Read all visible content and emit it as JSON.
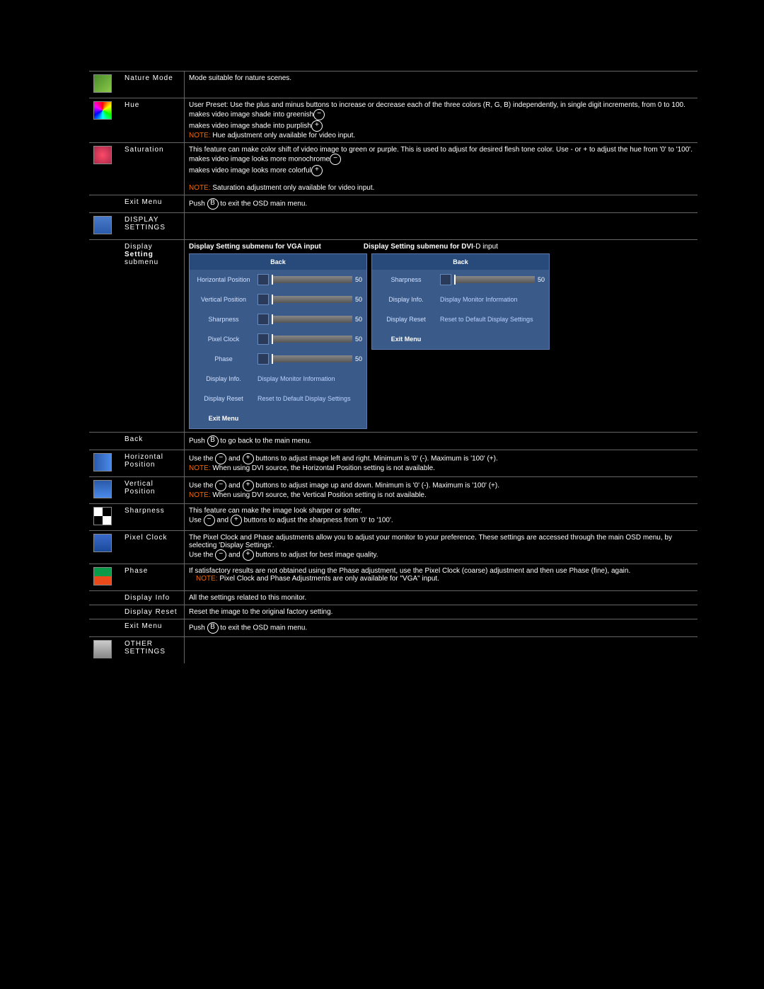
{
  "rows": [
    {
      "icon": "nature-icon",
      "label": "Nature Mode",
      "desc": [
        {
          "t": "Mode suitable for nature scenes."
        }
      ]
    },
    {
      "icon": "hue-icon",
      "label": "Hue",
      "desc": [
        {
          "t": "User Preset: Use the plus and minus buttons to increase or decrease each of the three colors (R, G, B) independently, in single digit increments, from 0 to 100."
        },
        {
          "ico": "-",
          "t": " makes video image shade into greenish"
        },
        {
          "ico": "+",
          "t": " makes video image shade into purplish"
        },
        {
          "note": "NOTE:",
          "t": " Hue adjustment only available for video input."
        }
      ]
    },
    {
      "icon": "saturation-icon",
      "label": "Saturation",
      "desc": [
        {
          "t": "This feature can make color shift of video image to green or purple. This is used to adjust for desired flesh tone color. Use - or + to adjust the hue from '0' to '100'."
        },
        {
          "ico": "-",
          "t": " makes video image looks more monochrome"
        },
        {
          "ico": "+",
          "t": " makes video image looks more colorful"
        },
        {
          "br": 1
        },
        {
          "note": "NOTE:",
          "t": " Saturation adjustment only available for video input."
        }
      ]
    },
    {
      "label": "Exit Menu",
      "desc": [
        {
          "t": "Push ",
          "ico2": "B",
          "t2": " to exit the OSD main menu."
        }
      ]
    },
    {
      "icon": "display-settings-icon",
      "label": "DISPLAY SETTINGS",
      "hdr": 1,
      "empty": 1
    },
    {
      "label": "Display",
      "label2": "Setting",
      "label3": "submenu",
      "osd": 1,
      "h1": "Display Setting  submenu for VGA input",
      "h2": "Display Setting  submenu for DVI-D input",
      "vga": [
        {
          "k": "Back",
          "back": 1
        },
        {
          "k": "Horizontal Position",
          "v": "50",
          "s": 1
        },
        {
          "k": "Vertical Position",
          "v": "50",
          "s": 1
        },
        {
          "k": "Sharpness",
          "v": "50",
          "s": 1
        },
        {
          "k": "Pixel Clock",
          "v": "50",
          "s": 1
        },
        {
          "k": "Phase",
          "v": "50",
          "s": 1
        },
        {
          "k": "Display Info.",
          "a": "Display Monitor Information"
        },
        {
          "k": "Display Reset",
          "a": "Reset to Default Display Settings"
        },
        {
          "k": "Exit Menu",
          "bold": 1
        }
      ],
      "dvi": [
        {
          "k": "Back",
          "back": 1
        },
        {
          "k": "Sharpness",
          "v": "50",
          "s": 1
        },
        {
          "k": "Display Info.",
          "a": "Display Monitor Information"
        },
        {
          "k": "Display Reset",
          "a": "Reset to Default Display Settings"
        },
        {
          "k": "Exit Menu",
          "bold": 1
        }
      ]
    },
    {
      "label": "Back",
      "desc": [
        {
          "t": "Push ",
          "ico2": "B",
          "t2": " to go back to the main menu."
        }
      ]
    },
    {
      "icon": "hpos-icon",
      "label": "Horizontal Position",
      "desc": [
        {
          "t": "Use the ",
          "ico": "-",
          "t1": " and ",
          "ico1": "+",
          "t2": " buttons to adjust image left and right. Minimum is '0' (-). Maximum is '100' (+)."
        },
        {
          "note": "NOTE:",
          "t": " When using DVI source, the Horizontal Position setting is not available."
        }
      ]
    },
    {
      "icon": "vpos-icon",
      "label": "Vertical Position",
      "desc": [
        {
          "t": "Use the ",
          "ico": "-",
          "t1": " and ",
          "ico1": "+",
          "t2": " buttons to adjust image up and down. Minimum is '0' (-). Maximum is '100' (+)."
        },
        {
          "note": "NOTE:",
          "t": " When using DVI source, the Vertical Position setting is not available."
        }
      ]
    },
    {
      "icon": "sharpness-icon",
      "label": "Sharpness",
      "desc": [
        {
          "t": "This feature can make the image look sharper or softer."
        },
        {
          "t": "Use  ",
          "ico": "-",
          "t1": " and ",
          "ico1": "+",
          "t2": " buttons to adjust the sharpness from '0' to '100'."
        }
      ]
    },
    {
      "icon": "pixelclock-icon",
      "label": "Pixel Clock",
      "desc": [
        {
          "t": "The Pixel Clock and Phase adjustments allow you to adjust your monitor to your preference. These settings are accessed through the main OSD menu, by selecting 'Display Settings'."
        },
        {
          "t": "Use the ",
          "ico": "-",
          "t1": " and ",
          "ico1": "+",
          "t2": " buttons to adjust for best image quality."
        }
      ]
    },
    {
      "icon": "phase-icon",
      "label": "Phase",
      "desc": [
        {
          "t": "If satisfactory results are not obtained using the Phase adjustment, use the Pixel Clock (coarse) adjustment and then use Phase (fine), again."
        },
        {
          "nbsp": 1,
          "note": "NOTE:",
          "t": " Pixel Clock and Phase Adjustments are only available for \"VGA\" input."
        }
      ]
    },
    {
      "label": "Display Info",
      "desc": [
        {
          "t": "All the settings related to this monitor."
        }
      ]
    },
    {
      "label": "Display Reset",
      "desc": [
        {
          "t": "Reset the image to the original factory setting."
        }
      ]
    },
    {
      "label": "Exit Menu",
      "desc": [
        {
          "t": "Push ",
          "ico2": "B",
          "t2": " to exit the OSD main menu."
        }
      ]
    },
    {
      "icon": "other-settings-icon",
      "label": "OTHER SETTINGS",
      "hdr": 1,
      "empty": 1
    }
  ],
  "iconColors": {
    "nature-icon": "linear-gradient(135deg,#4a8a2a,#8aca4a)",
    "hue-icon": "conic-gradient(red,yellow,lime,cyan,blue,magenta,red)",
    "saturation-icon": "radial-gradient(#ff4a6a,#aa2a4a)",
    "display-settings-icon": "linear-gradient(#4a7aca,#2a5aaa)",
    "hpos-icon": "linear-gradient(90deg,#2a5aaa,#4a8aea)",
    "vpos-icon": "linear-gradient(#2a5aaa,#4a8aea)",
    "sharpness-icon": "repeating-conic-gradient(#000 0 25%,#fff 0 50%)",
    "pixelclock-icon": "linear-gradient(#3a6aca,#1a4a9a)",
    "phase-icon": "linear-gradient(180deg,#0a9a4a 50%,#ea4a1a 50%)",
    "other-settings-icon": "linear-gradient(#ccc,#888)"
  }
}
